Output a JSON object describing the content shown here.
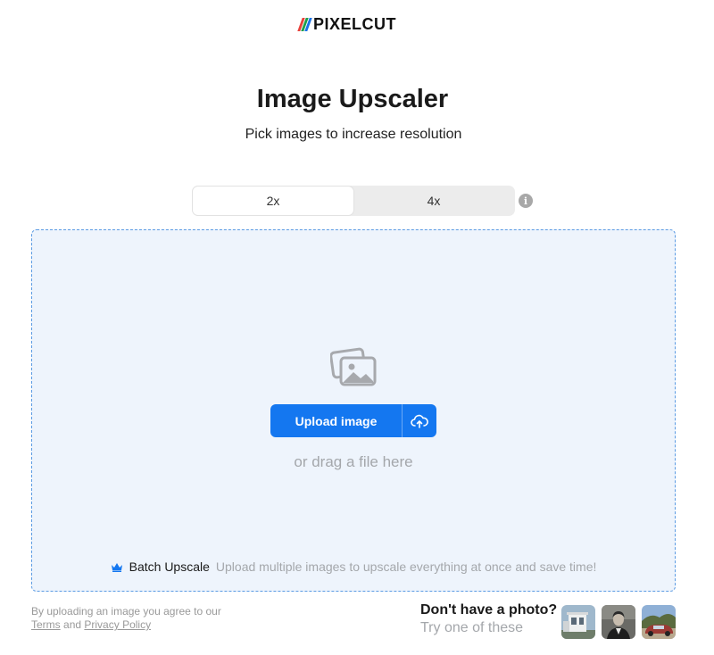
{
  "brand": {
    "name": "PIXELCUT",
    "stripe_colors": [
      "#e8413a",
      "#1e9e4a",
      "#1a73e8"
    ]
  },
  "hero": {
    "title": "Image Upscaler",
    "subtitle": "Pick images to increase resolution"
  },
  "scale_options": [
    {
      "label": "2x",
      "selected": true
    },
    {
      "label": "4x",
      "selected": false
    }
  ],
  "info_icon": "i",
  "upload": {
    "button_label": "Upload image",
    "drag_text": "or drag a file here",
    "accent_color": "#1477f0"
  },
  "batch": {
    "label": "Batch Upscale",
    "description": "Upload multiple images to upscale everything at once and save time!"
  },
  "legal": {
    "prefix": "By uploading an image you agree to our",
    "terms": "Terms",
    "and": "and",
    "privacy": "Privacy Policy"
  },
  "samples": {
    "title": "Don't have a photo?",
    "subtitle": "Try one of these",
    "thumbnails": [
      "building-photo",
      "portrait-photo",
      "car-photo"
    ]
  }
}
